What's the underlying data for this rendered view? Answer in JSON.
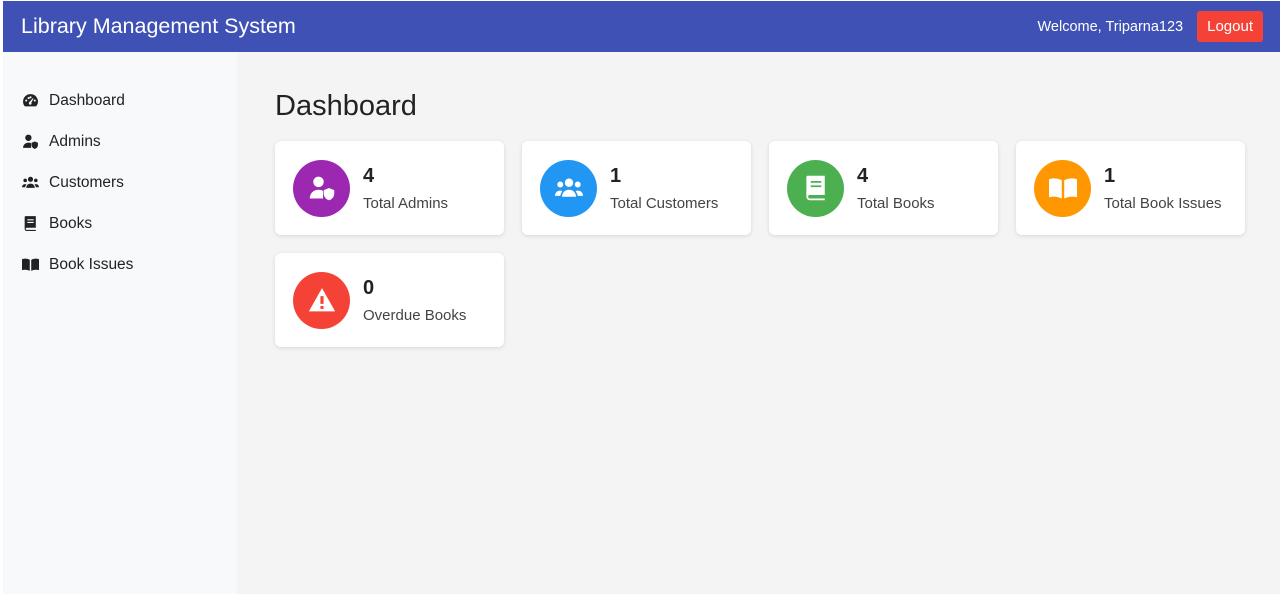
{
  "header": {
    "title": "Library Management System",
    "welcome": "Welcome, Triparna123",
    "logout_label": "Logout"
  },
  "sidebar": {
    "items": [
      {
        "label": "Dashboard",
        "icon": "gauge-icon"
      },
      {
        "label": "Admins",
        "icon": "user-shield-icon"
      },
      {
        "label": "Customers",
        "icon": "users-icon"
      },
      {
        "label": "Books",
        "icon": "book-icon"
      },
      {
        "label": "Book Issues",
        "icon": "book-open-icon"
      }
    ]
  },
  "main": {
    "title": "Dashboard",
    "cards": [
      {
        "value": "4",
        "label": "Total Admins",
        "color": "#9c27b0",
        "icon": "user-shield-icon"
      },
      {
        "value": "1",
        "label": "Total Customers",
        "color": "#2196f3",
        "icon": "users-icon"
      },
      {
        "value": "4",
        "label": "Total Books",
        "color": "#4caf50",
        "icon": "book-icon"
      },
      {
        "value": "1",
        "label": "Total Book Issues",
        "color": "#ff9800",
        "icon": "book-open-icon"
      },
      {
        "value": "0",
        "label": "Overdue Books",
        "color": "#f44336",
        "icon": "warning-icon"
      }
    ]
  },
  "colors": {
    "header_bg": "#3f51b5",
    "logout_bg": "#f44336",
    "sidebar_bg": "#f8f9fb",
    "main_bg": "#f4f4f4"
  }
}
